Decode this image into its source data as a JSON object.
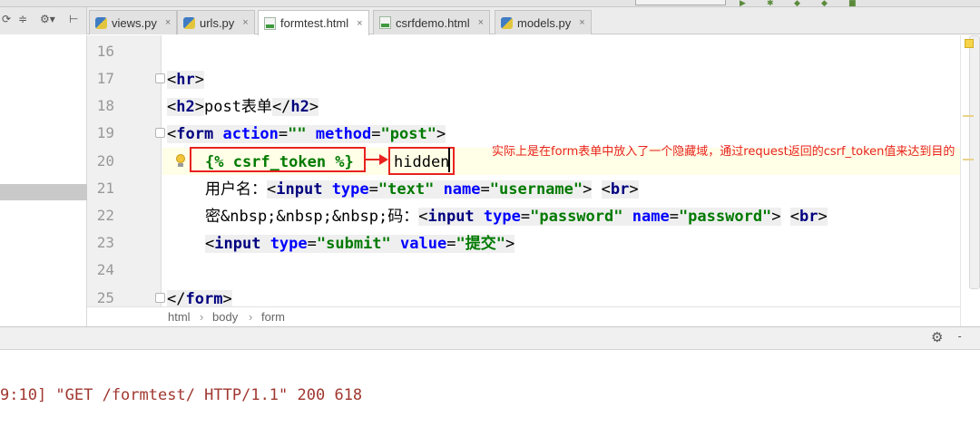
{
  "tabs": [
    {
      "label": "views.py",
      "icon": "python-file-icon",
      "active": false
    },
    {
      "label": "urls.py",
      "icon": "python-file-icon",
      "active": false
    },
    {
      "label": "formtest.html",
      "icon": "html-file-icon",
      "active": true
    },
    {
      "label": "csrfdemo.html",
      "icon": "html-file-icon",
      "active": false
    },
    {
      "label": "models.py",
      "icon": "python-file-icon",
      "active": false
    }
  ],
  "tab_close_glyph": "×",
  "editor": {
    "line_numbers": [
      "16",
      "17",
      "18",
      "19",
      "20",
      "21",
      "22",
      "23",
      "24",
      "25"
    ],
    "lines": {
      "l17": {
        "lt": "<",
        "tag": "hr",
        "gt": ">"
      },
      "l18": {
        "lt": "<",
        "tag": "h2",
        "gt": ">",
        "text": "post表单",
        "close_lt": "</",
        "close_tag": "h2",
        "close_gt": ">"
      },
      "l19": {
        "lt": "<",
        "tag": "form",
        "sp1": " ",
        "attr1": "action",
        "eq1": "=",
        "val1": "\"\"",
        "sp2": " ",
        "attr2": "method",
        "eq2": "=",
        "val2": "\"post\"",
        "gt": ">"
      },
      "l20": {
        "token": "{% csrf_token %}",
        "hidden": "hidden"
      },
      "l21": {
        "label": "用户名：",
        "lt": "<",
        "tag": "input",
        "sp1": " ",
        "attr1": "type",
        "eq1": "=",
        "val1": "\"text\"",
        "sp2": " ",
        "attr2": "name",
        "eq2": "=",
        "val2": "\"username\"",
        "gt": ">",
        "sp3": " ",
        "br_lt": "<",
        "br": "br",
        "br_gt": ">"
      },
      "l22": {
        "label": "密&nbsp;&nbsp;&nbsp;码：",
        "lt": "<",
        "tag": "input",
        "sp1": " ",
        "attr1": "type",
        "eq1": "=",
        "val1": "\"password\"",
        "sp2": " ",
        "attr2": "name",
        "eq2": "=",
        "val2": "\"password\"",
        "gt": ">",
        "sp3": " ",
        "br_lt": "<",
        "br": "br",
        "br_gt": ">"
      },
      "l23": {
        "lt": "<",
        "tag": "input",
        "sp1": " ",
        "attr1": "type",
        "eq1": "=",
        "val1": "\"submit\"",
        "sp2": " ",
        "attr2": "value",
        "eq2": "=",
        "val2": "\"提交\"",
        "gt": ">"
      },
      "l25": {
        "lt": "</",
        "tag": "form",
        "gt": ">"
      }
    },
    "annotation": "实际上是在form表单中放入了一个隐藏域，通过request返回的csrf_token值来达到目的"
  },
  "breadcrumb": [
    "html",
    "body",
    "form"
  ],
  "console": {
    "log_line": "9:10] \"GET /formtest/ HTTP/1.1\" 200 618"
  },
  "colors": {
    "annotation_red": "#e8231f",
    "tag_blue": "#00007f",
    "attr_blue": "#0000ff",
    "value_green": "#007a00",
    "console_text": "#a0372f"
  }
}
